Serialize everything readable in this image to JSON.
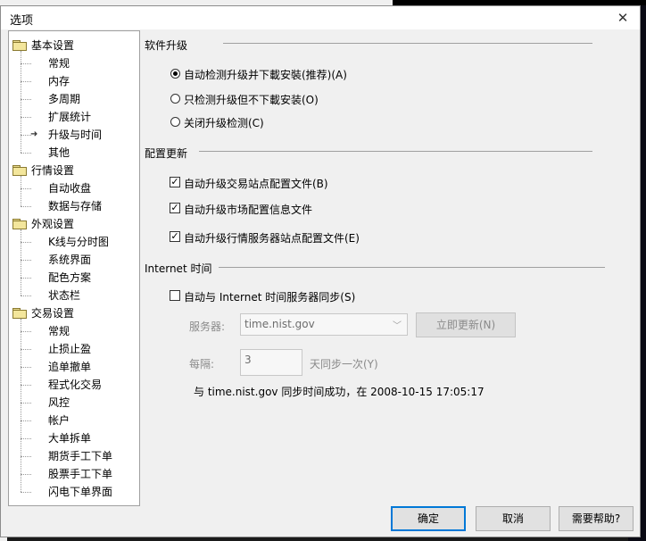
{
  "dialog": {
    "title": "选项",
    "close_glyph": "✕"
  },
  "tree": {
    "groups": [
      {
        "label": "基本设置",
        "children": [
          "常规",
          "内存",
          "多周期",
          "扩展统计",
          "升级与时间",
          "其他"
        ]
      },
      {
        "label": "行情设置",
        "children": [
          "自动收盘",
          "数据与存储"
        ]
      },
      {
        "label": "外观设置",
        "children": [
          "K线与分时图",
          "系统界面",
          "配色方案",
          "状态栏"
        ]
      },
      {
        "label": "交易设置",
        "children": [
          "常规",
          "止损止盈",
          "追单撤单",
          "程式化交易",
          "风控",
          "帐户",
          "大单拆单",
          "期货手工下单",
          "股票手工下单",
          "闪电下单界面"
        ]
      }
    ],
    "selected": "升级与时间"
  },
  "upgrade": {
    "title": "软件升级",
    "options": [
      {
        "label": "自动检测升级并下載安裝(推荐)(A)",
        "checked": true
      },
      {
        "label": "只检测升级但不下載安装(O)",
        "checked": false
      },
      {
        "label": "关闭升级检测(C)",
        "checked": false
      }
    ]
  },
  "config": {
    "title": "配置更新",
    "options": [
      {
        "label": "自动升级交易站点配置文件(B)",
        "checked": true
      },
      {
        "label": "自动升级市场配置信息文件",
        "checked": true
      },
      {
        "label": "自动升级行情服务器站点配置文件(E)",
        "checked": true
      }
    ]
  },
  "internet": {
    "title": "Internet 时间",
    "sync_label": "自动与 Internet 时间服务器同步(S)",
    "sync_checked": false,
    "server_label": "服务器:",
    "server_value": "time.nist.gov",
    "update_now_label": "立即更新(N)",
    "interval_label": "每隔:",
    "interval_value": "3",
    "interval_suffix": "天同步一次(Y)",
    "status_text": "与 time.nist.gov 同步时间成功，在 2008-10-15 17:05:17"
  },
  "buttons": {
    "ok": "确定",
    "cancel": "取消",
    "help": "需要帮助?"
  }
}
